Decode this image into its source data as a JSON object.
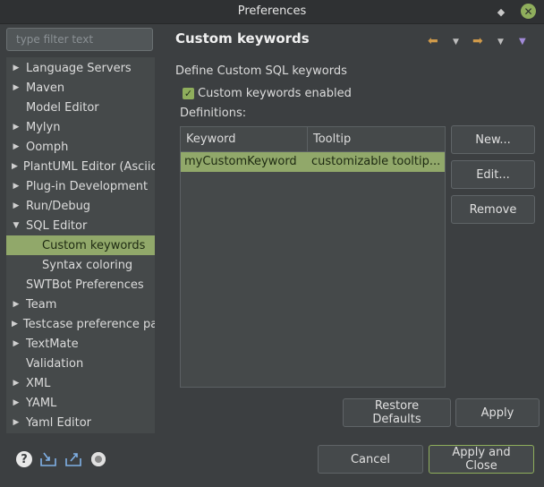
{
  "window": {
    "title": "Preferences",
    "restore_icon": "restore-icon",
    "close_icon": "close-icon"
  },
  "filter": {
    "placeholder": "type filter text"
  },
  "tree": {
    "items": [
      {
        "label": "Language Servers",
        "arrow": "▶"
      },
      {
        "label": "Maven",
        "arrow": "▶"
      },
      {
        "label": "Model Editor",
        "arrow": ""
      },
      {
        "label": "Mylyn",
        "arrow": "▶"
      },
      {
        "label": "Oomph",
        "arrow": "▶"
      },
      {
        "label": "PlantUML Editor (Asciido",
        "arrow": "▶"
      },
      {
        "label": "Plug-in Development",
        "arrow": "▶"
      },
      {
        "label": "Run/Debug",
        "arrow": "▶"
      },
      {
        "label": "SQL Editor",
        "arrow": "▼"
      },
      {
        "label": "Custom keywords",
        "arrow": ""
      },
      {
        "label": "Syntax coloring",
        "arrow": ""
      },
      {
        "label": "SWTBot Preferences",
        "arrow": ""
      },
      {
        "label": "Team",
        "arrow": "▶"
      },
      {
        "label": "Testcase preference pag",
        "arrow": "▶"
      },
      {
        "label": "TextMate",
        "arrow": "▶"
      },
      {
        "label": "Validation",
        "arrow": ""
      },
      {
        "label": "XML",
        "arrow": "▶"
      },
      {
        "label": "YAML",
        "arrow": "▶"
      },
      {
        "label": "Yaml Editor",
        "arrow": "▶"
      }
    ]
  },
  "page": {
    "title": "Custom keywords",
    "description": "Define Custom SQL keywords",
    "checkbox_label": "Custom keywords enabled",
    "checkbox_checked": true,
    "definitions_label": "Definitions:",
    "table": {
      "columns": [
        "Keyword",
        "Tooltip"
      ],
      "rows": [
        {
          "keyword": "myCustomKeyword",
          "tooltip": "customizable tooltip..."
        }
      ]
    },
    "buttons": {
      "new": "New...",
      "edit": "Edit...",
      "remove": "Remove",
      "restore_defaults": "Restore Defaults",
      "apply": "Apply"
    }
  },
  "footer": {
    "cancel": "Cancel",
    "apply_and_close": "Apply and Close"
  },
  "nav_icons": [
    "back-arrow-icon",
    "back-dropdown-icon",
    "forward-arrow-icon",
    "forward-dropdown-icon",
    "view-menu-icon"
  ],
  "footer_icons": [
    "help-icon",
    "import-icon",
    "export-icon",
    "record-icon"
  ],
  "colors": {
    "background": "#3c3f41",
    "selection": "#91a86a",
    "accent": "#8fae5c",
    "nav_arrow": "#d09a4a"
  }
}
